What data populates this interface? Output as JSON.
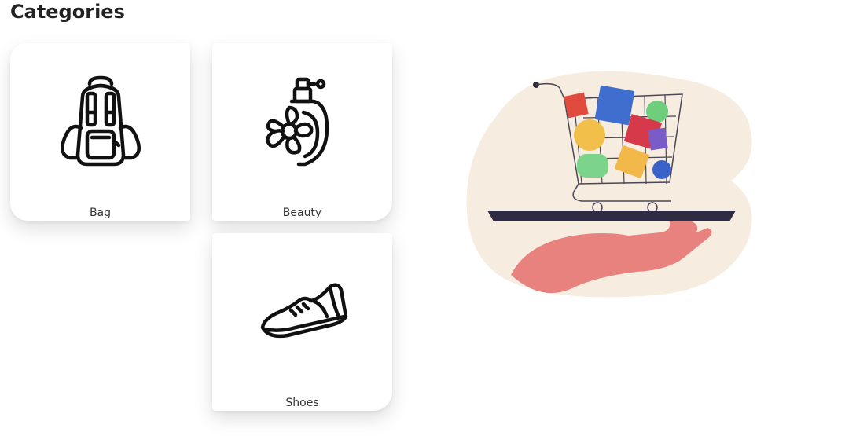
{
  "page": {
    "title": "Categories"
  },
  "categories": [
    {
      "label": "Bag",
      "icon": "backpack-icon"
    },
    {
      "label": "Beauty",
      "icon": "perfume-icon"
    },
    {
      "label": "Shoes",
      "icon": "sneaker-icon"
    }
  ],
  "illustration": {
    "name": "shopping-cart-on-hand-illustration"
  }
}
